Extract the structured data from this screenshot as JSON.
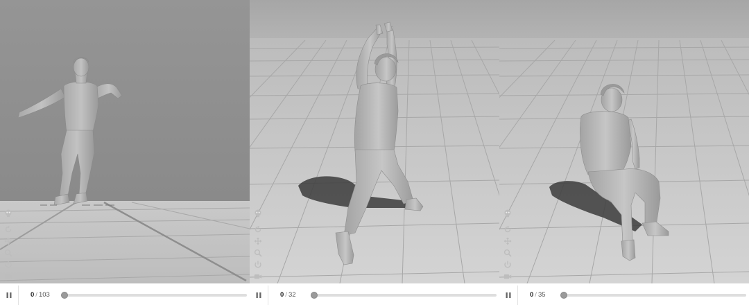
{
  "viewers": [
    {
      "name": "viewer-1",
      "pose": "dancing",
      "frame": {
        "current": "0",
        "separator": "/",
        "total": "103"
      },
      "progress": 0,
      "tools": [
        "skeleton-icon",
        "rotate-icon",
        "move-icon",
        "zoom-icon",
        "reset-icon",
        "camera-icon"
      ]
    },
    {
      "name": "viewer-2",
      "pose": "arms-raised-lunge",
      "frame": {
        "current": "0",
        "separator": "/",
        "total": "32"
      },
      "progress": 0,
      "tools": [
        "skeleton-icon",
        "rotate-icon",
        "move-icon",
        "zoom-icon",
        "reset-icon",
        "camera-icon"
      ]
    },
    {
      "name": "viewer-3",
      "pose": "sitting",
      "frame": {
        "current": "0",
        "separator": "/",
        "total": "35"
      },
      "progress": 0,
      "tools": [
        "skeleton-icon",
        "rotate-icon",
        "move-icon",
        "zoom-icon",
        "reset-icon",
        "camera-icon"
      ]
    }
  ],
  "colors": {
    "wall": "#8c8c8c",
    "floor": "#c4c4c4",
    "grid_line": "#a4a4a4",
    "sky": "#a9a9a9",
    "figure": "#b6b6b6",
    "figure_shade": "#8f8f8f",
    "shadow": "#3a3a3a"
  }
}
